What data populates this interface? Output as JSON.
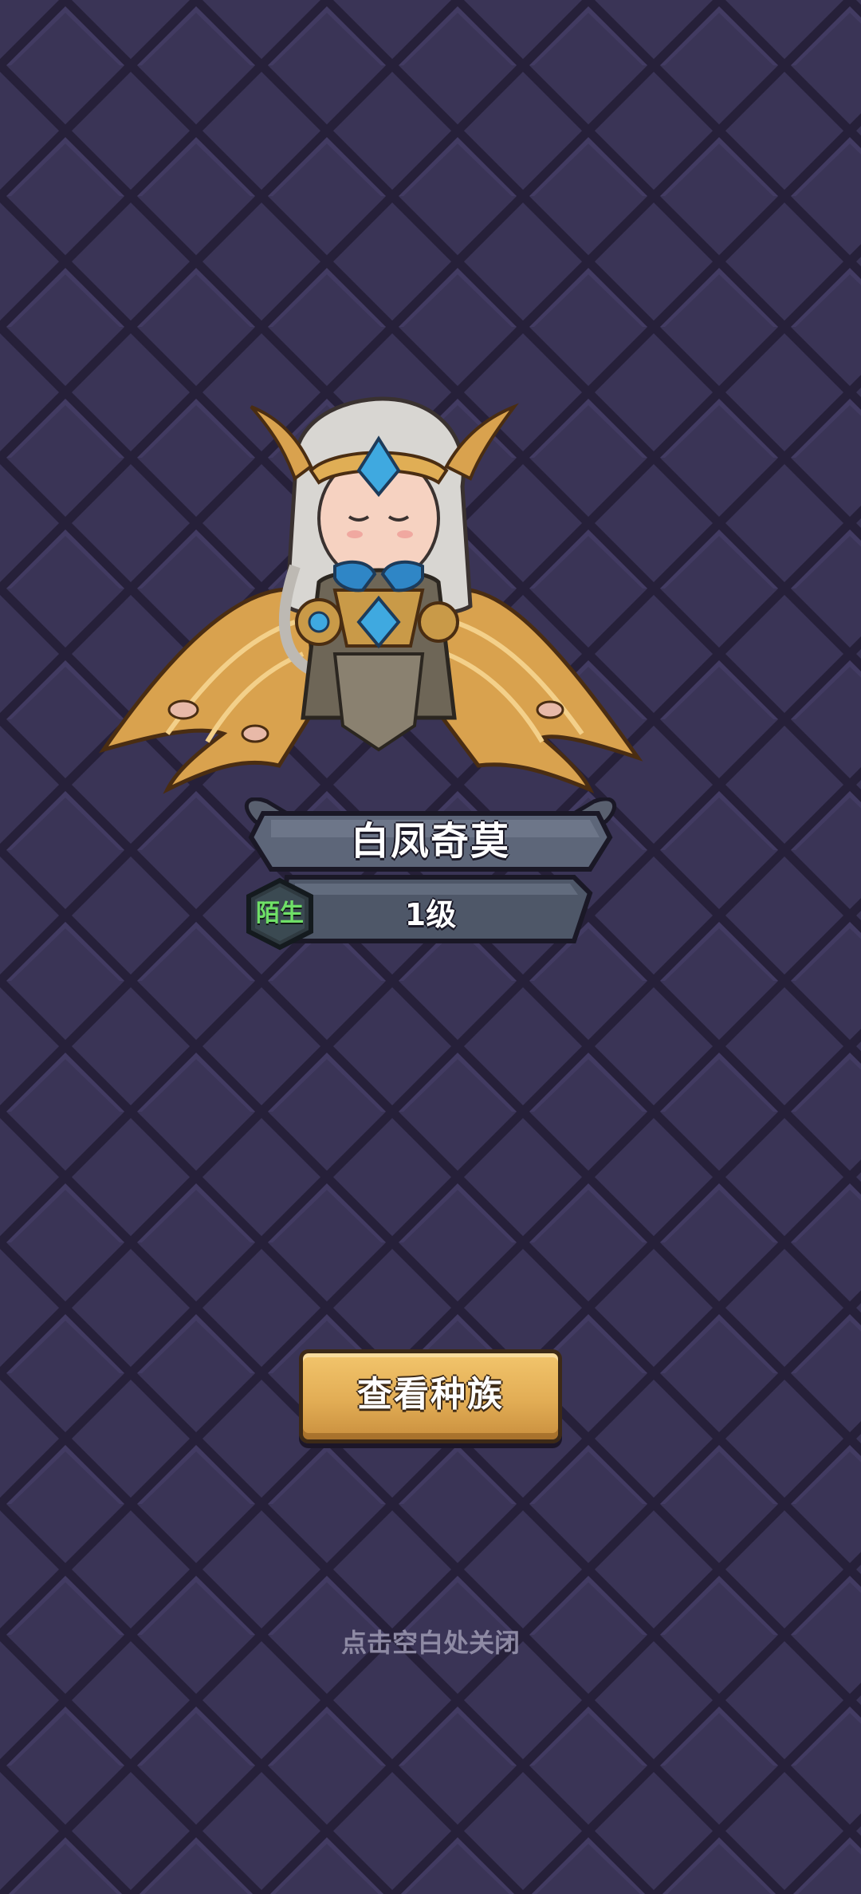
{
  "popup": {
    "hero_name": "白凤奇莫",
    "relation_tag": "陌生",
    "level_text": "1级",
    "portrait": "winged-valkyrie-hero-portrait",
    "race_button_label": "查看种族",
    "close_hint": "点击空白处关闭"
  },
  "colors": {
    "background": "#2f2a47",
    "tile_dark": "#252039",
    "tile_light": "#3a3456",
    "nameplate": "#5e6a7c",
    "button_gold": "#e2ad55",
    "relation_green": "#6fe067",
    "hint_grey": "#8e8aa4"
  }
}
